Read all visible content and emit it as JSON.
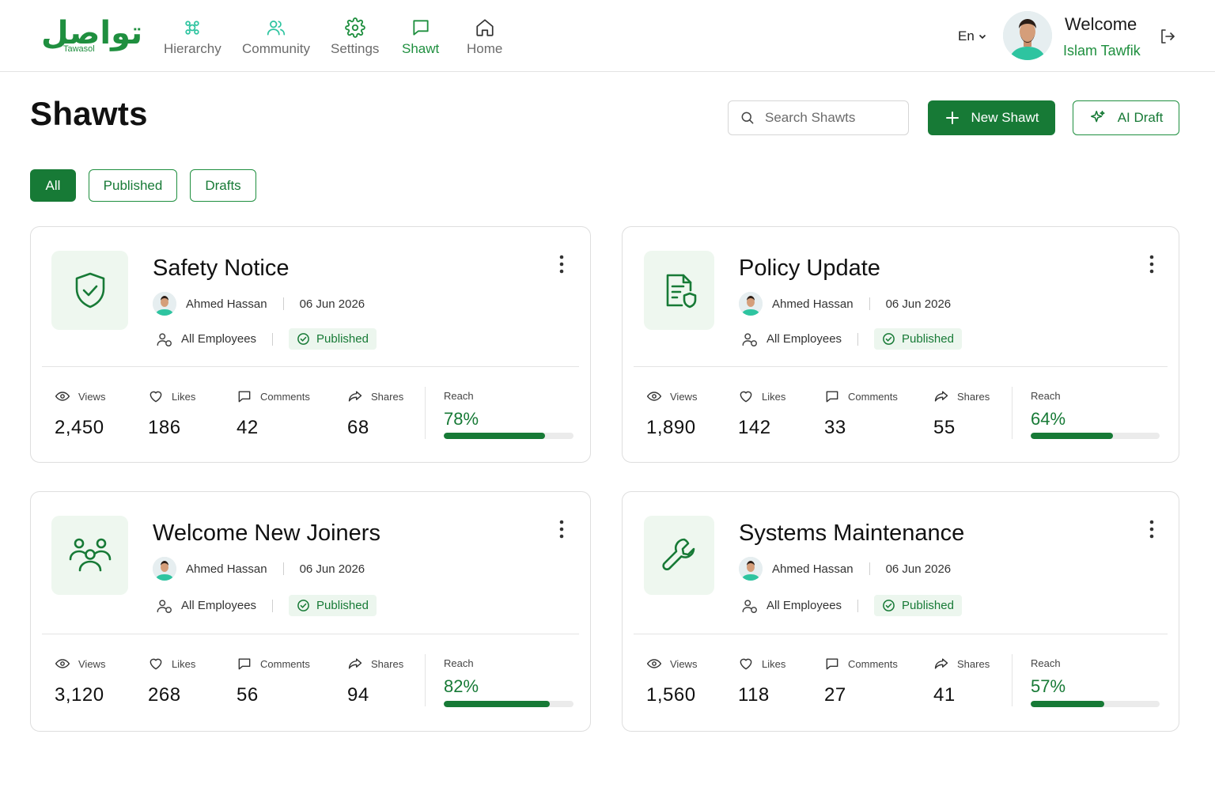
{
  "brand": {
    "logo_ar": "تواصل",
    "logo_en": "Tawasol"
  },
  "nav": [
    {
      "label": "Hierarchy",
      "icon": "hierarchy-icon"
    },
    {
      "label": "Community",
      "icon": "community-icon"
    },
    {
      "label": "Settings",
      "icon": "settings-icon"
    },
    {
      "label": "Shawt",
      "icon": "shawt-icon",
      "active": true
    },
    {
      "label": "Home",
      "icon": "home-icon"
    }
  ],
  "header": {
    "language": "En",
    "welcome": "Welcome",
    "user_name": "Islam Tawfik"
  },
  "page": {
    "title": "Shawts",
    "search_placeholder": "Search Shawts",
    "new_button": "New Shawt",
    "ai_button": "AI Draft"
  },
  "filters": [
    "All",
    "Published",
    "Drafts"
  ],
  "active_filter": "All",
  "stat_labels": {
    "views": "Views",
    "likes": "Likes",
    "comments": "Comments",
    "shares": "Shares",
    "reach": "Reach"
  },
  "cards": [
    {
      "title": "Safety Notice",
      "icon": "shield-check-icon",
      "author": "Ahmed Hassan",
      "date": "06 Jun 2026",
      "audience": "All Employees",
      "status": "Published",
      "views": "2,450",
      "likes": "186",
      "comments": "42",
      "shares": "68",
      "reach": "78%",
      "reach_fraction": 0.78
    },
    {
      "title": "Policy Update",
      "icon": "document-shield-icon",
      "author": "Ahmed Hassan",
      "date": "06 Jun 2026",
      "audience": "All Employees",
      "status": "Published",
      "views": "1,890",
      "likes": "142",
      "comments": "33",
      "shares": "55",
      "reach": "64%",
      "reach_fraction": 0.64
    },
    {
      "title": "Welcome New Joiners",
      "icon": "people-group-icon",
      "author": "Ahmed Hassan",
      "date": "06 Jun 2026",
      "audience": "All Employees",
      "status": "Published",
      "views": "3,120",
      "likes": "268",
      "comments": "56",
      "shares": "94",
      "reach": "82%",
      "reach_fraction": 0.82
    },
    {
      "title": "Systems Maintenance",
      "icon": "wrench-icon",
      "author": "Ahmed Hassan",
      "date": "06 Jun 2026",
      "audience": "All Employees",
      "status": "Published",
      "views": "1,560",
      "likes": "118",
      "comments": "27",
      "shares": "41",
      "reach": "57%",
      "reach_fraction": 0.57
    }
  ],
  "colors": {
    "brand_green": "#177a36",
    "accent_green": "#1f8f3f",
    "nav_active": "#1f8f3f",
    "icon_mint": "#2ec4a0",
    "badge_bg": "#ecf6ee"
  }
}
